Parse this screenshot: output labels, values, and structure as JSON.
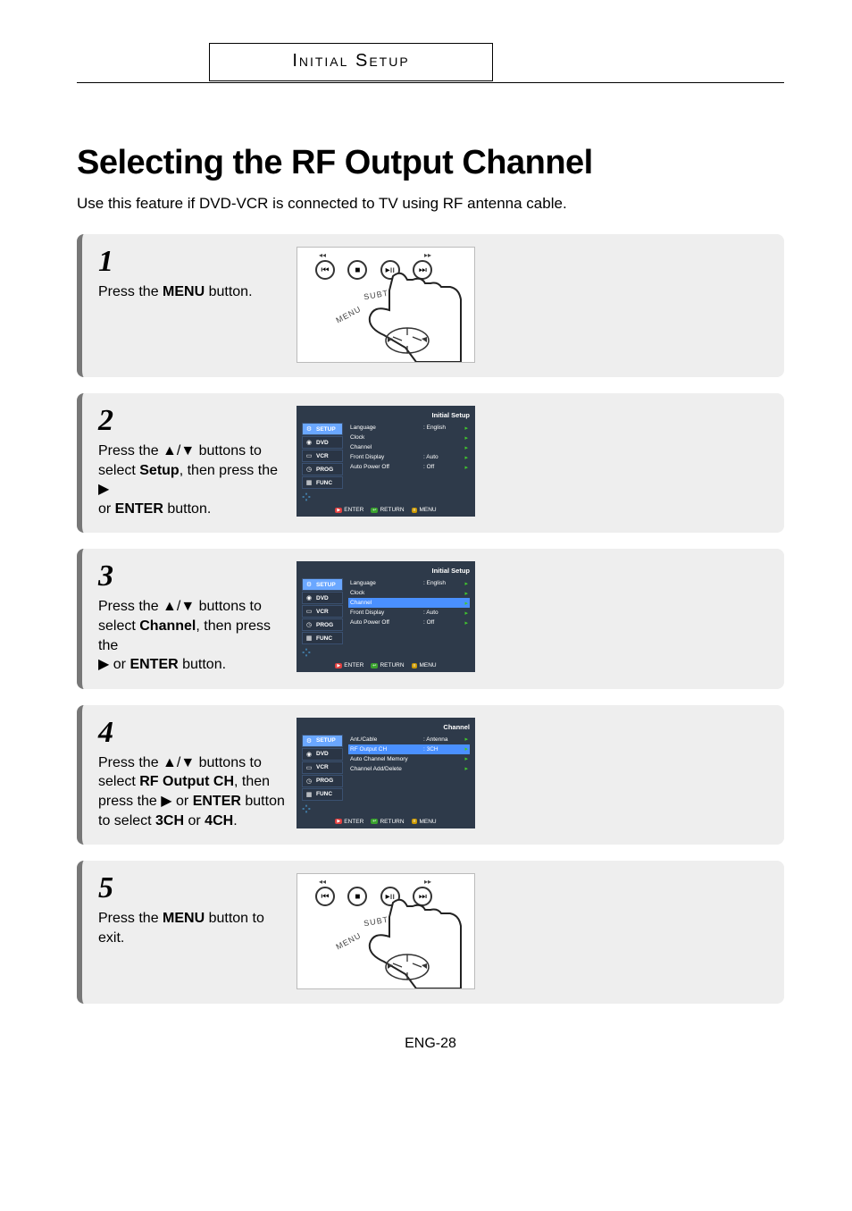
{
  "header": {
    "section": "Initial Setup"
  },
  "title": "Selecting the RF Output Channel",
  "intro": "Use this feature if DVD-VCR is connected to TV using RF antenna cable.",
  "page_num": "ENG-28",
  "steps": [
    {
      "num": "1",
      "text_pre": "Press the ",
      "bold1": "MENU",
      "text_post": " button.",
      "image": "remote",
      "remote_labels": {
        "subtitle": "SUBTITLE",
        "menu": "MENU"
      }
    },
    {
      "num": "2",
      "line1_pre": "Press the ",
      "line1_sym": "▲/▼",
      "line1_post": " buttons to",
      "line2_pre": "select ",
      "line2_bold": "Setup",
      "line2_post": ", then press the ",
      "line2_sym": "▶",
      "line3_pre": "or ",
      "line3_bold": "ENTER",
      "line3_post": " button.",
      "osd": {
        "title": "Initial Setup",
        "side": [
          "SETUP",
          "DVD",
          "VCR",
          "PROG",
          "FUNC"
        ],
        "side_active": 0,
        "rows": [
          {
            "label": "Language",
            "value": ": English",
            "hl": false
          },
          {
            "label": "Clock",
            "value": "",
            "hl": false
          },
          {
            "label": "Channel",
            "value": "",
            "hl": false
          },
          {
            "label": "Front Display",
            "value": ": Auto",
            "hl": false
          },
          {
            "label": "Auto Power Off",
            "value": ": Off",
            "hl": false
          }
        ],
        "footer": [
          "ENTER",
          "RETURN",
          "MENU"
        ]
      }
    },
    {
      "num": "3",
      "line1_pre": "Press the ",
      "line1_sym": "▲/▼",
      "line1_post": " buttons to",
      "line2_pre": "select ",
      "line2_bold": "Channel",
      "line2_post": ", then press the",
      "line3_sym": "▶",
      "line3_pre": " or ",
      "line3_bold": "ENTER",
      "line3_post": " button.",
      "osd": {
        "title": "Initial Setup",
        "side": [
          "SETUP",
          "DVD",
          "VCR",
          "PROG",
          "FUNC"
        ],
        "side_active": 0,
        "rows": [
          {
            "label": "Language",
            "value": ": English",
            "hl": false
          },
          {
            "label": "Clock",
            "value": "",
            "hl": false
          },
          {
            "label": "Channel",
            "value": "",
            "hl": true
          },
          {
            "label": "Front Display",
            "value": ": Auto",
            "hl": false
          },
          {
            "label": "Auto Power Off",
            "value": ": Off",
            "hl": false
          }
        ],
        "footer": [
          "ENTER",
          "RETURN",
          "MENU"
        ]
      }
    },
    {
      "num": "4",
      "line1_pre": "Press the ",
      "line1_sym": "▲/▼",
      "line1_post": " buttons to",
      "line2_pre": "select ",
      "line2_bold": "RF Output CH",
      "line2_post": ", then",
      "line3_pre": "press the ",
      "line3_sym": "▶",
      "line3_mid": " or ",
      "line3_bold": "ENTER",
      "line3_post": " button",
      "line4_pre": "to select ",
      "line4_bold1": "3CH",
      "line4_mid": " or ",
      "line4_bold2": "4CH",
      "line4_post": ".",
      "osd": {
        "title": "Channel",
        "side": [
          "SETUP",
          "DVD",
          "VCR",
          "PROG",
          "FUNC"
        ],
        "side_active": 0,
        "rows": [
          {
            "label": "Ant./Cable",
            "value": ": Antenna",
            "hl": false
          },
          {
            "label": "RF Output CH",
            "value": ": 3CH",
            "hl": true
          },
          {
            "label": "Auto Channel Memory",
            "value": "",
            "hl": false
          },
          {
            "label": "Channel Add/Delete",
            "value": "",
            "hl": false
          }
        ],
        "footer": [
          "ENTER",
          "RETURN",
          "MENU"
        ]
      }
    },
    {
      "num": "5",
      "text_pre": "Press the ",
      "bold1": "MENU",
      "text_post": " button to exit.",
      "image": "remote",
      "remote_labels": {
        "subtitle": "SUBTITLE",
        "menu": "MENU"
      }
    }
  ]
}
